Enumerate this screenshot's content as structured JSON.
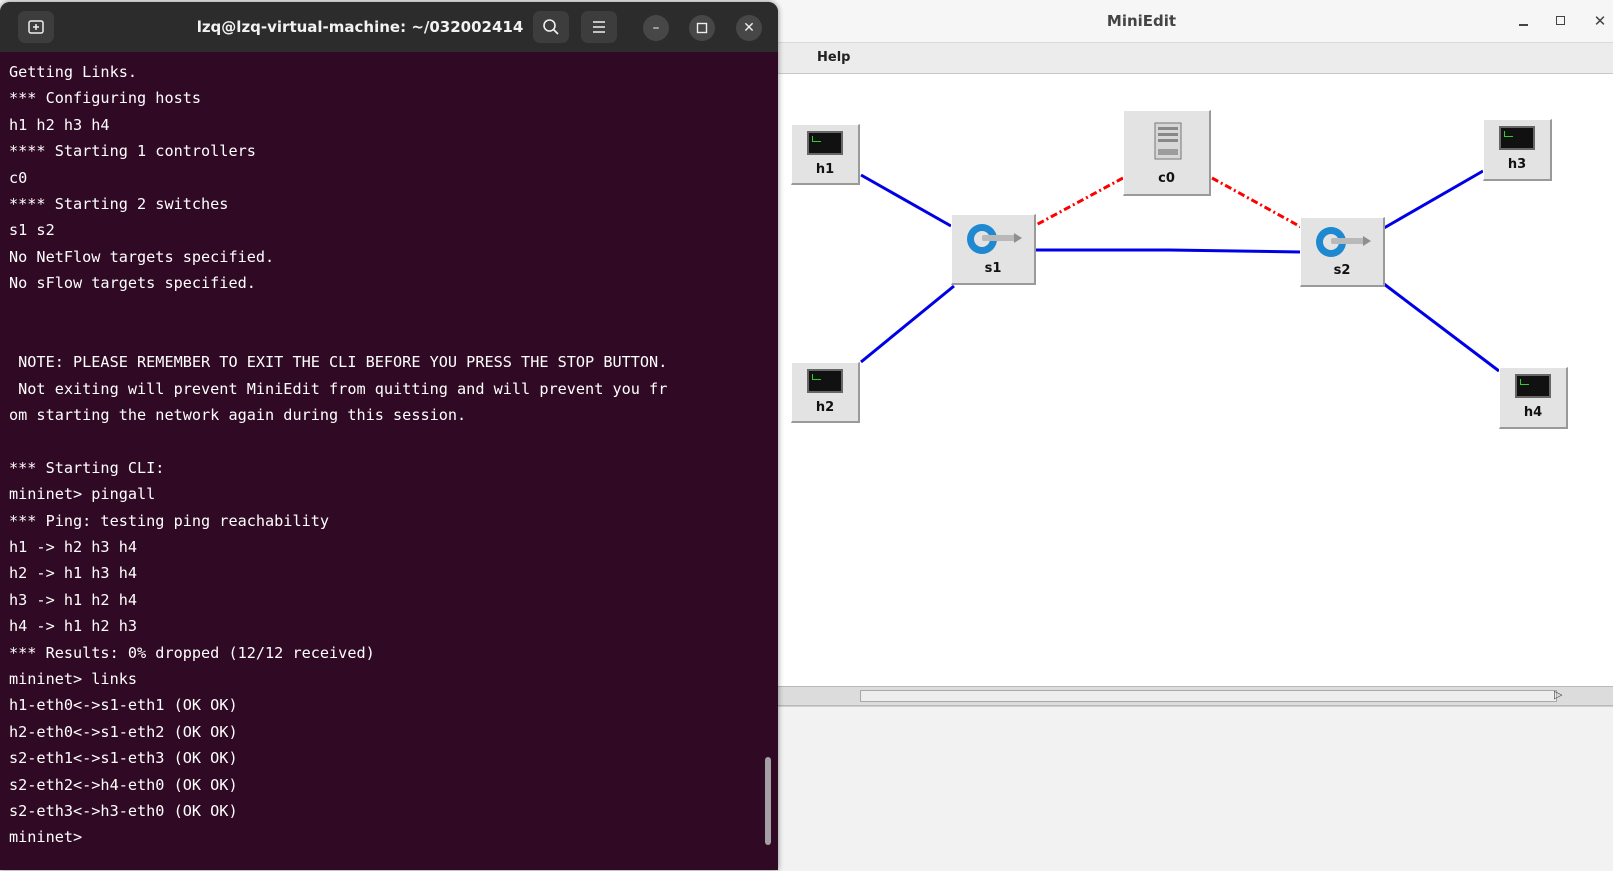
{
  "terminal": {
    "title": "lzq@lzq-virtual-machine: ~/032002414",
    "buttons": {
      "new_tab_icon": "new-tab-icon",
      "search_icon": "search-icon",
      "menu_icon": "hamburger-menu-icon",
      "minimize": "–",
      "maximize": "▫",
      "close": "✕"
    },
    "lines": [
      "Getting Links.",
      "*** Configuring hosts",
      "h1 h2 h3 h4",
      "**** Starting 1 controllers",
      "c0",
      "**** Starting 2 switches",
      "s1 s2",
      "No NetFlow targets specified.",
      "No sFlow targets specified.",
      "",
      "",
      " NOTE: PLEASE REMEMBER TO EXIT THE CLI BEFORE YOU PRESS THE STOP BUTTON.",
      " Not exiting will prevent MiniEdit from quitting and will prevent you fr",
      "om starting the network again during this session.",
      "",
      "*** Starting CLI:",
      "mininet> pingall",
      "*** Ping: testing ping reachability",
      "h1 -> h2 h3 h4",
      "h2 -> h1 h3 h4",
      "h3 -> h1 h2 h4",
      "h4 -> h1 h2 h3",
      "*** Results: 0% dropped (12/12 received)",
      "mininet> links",
      "h1-eth0<->s1-eth1 (OK OK)",
      "h2-eth0<->s1-eth2 (OK OK)",
      "s2-eth1<->s1-eth3 (OK OK)",
      "s2-eth2<->h4-eth0 (OK OK)",
      "s2-eth3<->h3-eth0 (OK OK)",
      "mininet> "
    ],
    "colors": {
      "background": "#300a24",
      "header": "#2c2c2c",
      "text": "#ffffff"
    }
  },
  "miniedit": {
    "title": "MiniEdit",
    "window_controls": {
      "minimize": "–",
      "maximize": "□",
      "close": "✕"
    },
    "menu": {
      "help": "Help"
    },
    "nodes": {
      "h1": "h1",
      "h2": "h2",
      "h3": "h3",
      "h4": "h4",
      "s1": "s1",
      "s2": "s2",
      "c0": "c0"
    },
    "colors": {
      "data_link": "#0000e6",
      "controller_link": "#ff0000"
    }
  }
}
